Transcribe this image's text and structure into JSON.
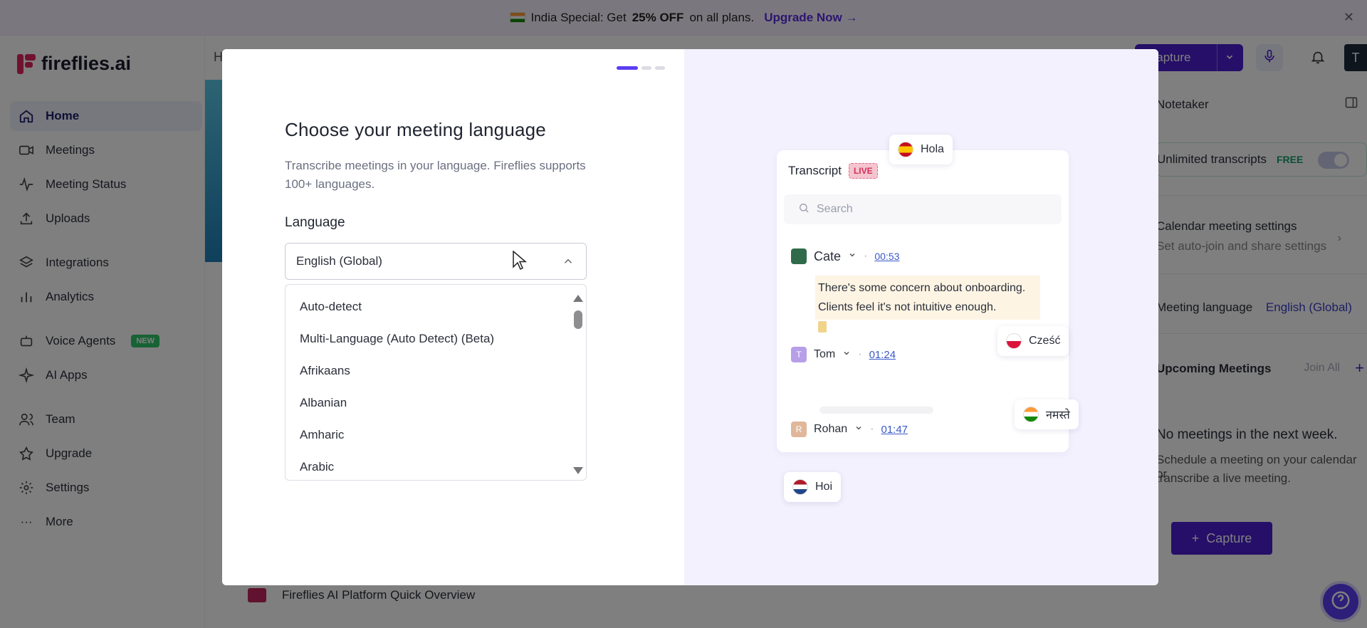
{
  "promo": {
    "text_prefix": "India Special: Get",
    "discount": "25% OFF",
    "text_suffix": "on all plans.",
    "upgrade_link": "Upgrade Now →"
  },
  "sidebar": {
    "logo": "fireflies.ai",
    "items": [
      {
        "label": "Home",
        "icon": "home-icon"
      },
      {
        "label": "Meetings",
        "icon": "video-icon"
      },
      {
        "label": "Meeting Status",
        "icon": "pulse-icon"
      },
      {
        "label": "Uploads",
        "icon": "upload-icon"
      },
      {
        "label": "Integrations",
        "icon": "layers-icon"
      },
      {
        "label": "Analytics",
        "icon": "bar-chart-icon"
      },
      {
        "label": "Voice Agents",
        "icon": "bot-icon",
        "badge": "NEW"
      },
      {
        "label": "AI Apps",
        "icon": "sparkle-icon"
      },
      {
        "label": "Team",
        "icon": "users-icon"
      },
      {
        "label": "Upgrade",
        "icon": "star-icon"
      },
      {
        "label": "Settings",
        "icon": "gear-icon"
      },
      {
        "label": "More",
        "icon": "dots-icon"
      }
    ]
  },
  "header": {
    "capture_label": "Capture",
    "avatar_letter": "T",
    "h_letter": "H"
  },
  "right_panel": {
    "notetaker": "Notetaker",
    "unlimited": "Unlimited transcripts",
    "free": "FREE",
    "cal_title": "Calendar meeting settings",
    "cal_sub": "Set auto-join and share settings",
    "lang_label": "Meeting language",
    "lang_value": "English (Global)",
    "upcoming": "Upcoming Meetings",
    "join_all": "Join All",
    "empty_title": "No meetings in the next week.",
    "empty_sub_1": "Schedule a meeting on your calendar or",
    "empty_sub_2": "transcribe a live meeting.",
    "capture_btn": "Capture"
  },
  "bottom": {
    "video_title": "Fireflies AI Platform Quick Overview"
  },
  "modal": {
    "title": "Choose your meeting language",
    "subtitle": "Transcribe meetings in your language. Fireflies supports 100+ languages.",
    "language_label": "Language",
    "selected": "English (Global)",
    "options": [
      "Auto-detect",
      "Multi-Language (Auto Detect) (Beta)",
      "Afrikaans",
      "Albanian",
      "Amharic",
      "Arabic"
    ]
  },
  "transcript": {
    "title": "Transcript",
    "live": "LIVE",
    "search_placeholder": "Search",
    "speakers": [
      {
        "name": "Cate",
        "time": "00:53",
        "initial": ""
      },
      {
        "name": "Tom",
        "time": "01:24",
        "initial": "T"
      },
      {
        "name": "Rohan",
        "time": "01:47",
        "initial": "R"
      }
    ],
    "quote": "There's some concern about onboarding. Clients feel it's not intuitive enough.",
    "greetings": {
      "spanish": "Hola",
      "polish": "Cześć",
      "hindi": "नमस्ते",
      "dutch": "Hoi"
    }
  },
  "colors": {
    "accent": "#5b3df2",
    "brand": "#e0245e",
    "capture": "#4a1fd0"
  }
}
